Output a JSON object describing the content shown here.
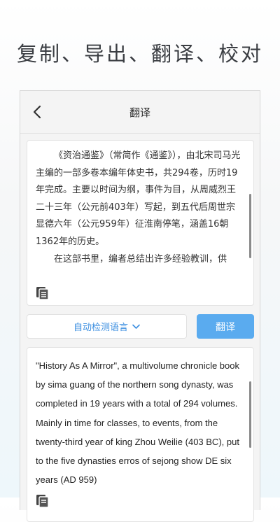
{
  "headline": "复制、导出、翻译、校对",
  "nav": {
    "title": "翻译",
    "back_icon": "chevron-left-icon"
  },
  "source": {
    "paragraphs": [
      "《资治通鉴》（常简作《通鉴》），由北宋司马光主编的一部多卷本编年体史书，共294卷，历时19年完成。主要以时间为纲，事件为目，从周威烈王二十三年（公元前403年）写起，到五代后周世宗显德六年（公元959年）征淮南停笔，涵盖16朝1362年的历史。",
      "在这部书里，编者总结出许多经验教训，供"
    ],
    "copy_icon": "copy-icon"
  },
  "controls": {
    "language_select": "自动检测语言",
    "translate_button": "翻译"
  },
  "result": {
    "text": "\"History As A Mirror\", a multivolume chronicle book by sima guang of the northern song dynasty, was completed in 19 years with a total of 294 volumes. Mainly in time for classes, to events, from the twenty-third year of king Zhou Weilie (403 BC), put to the five dynasties erros of sejong show DE six years (AD 959)",
    "copy_icon": "copy-icon"
  },
  "colors": {
    "accent": "#5aabef",
    "link": "#3d8fe0",
    "background": "#f4f4f4"
  }
}
